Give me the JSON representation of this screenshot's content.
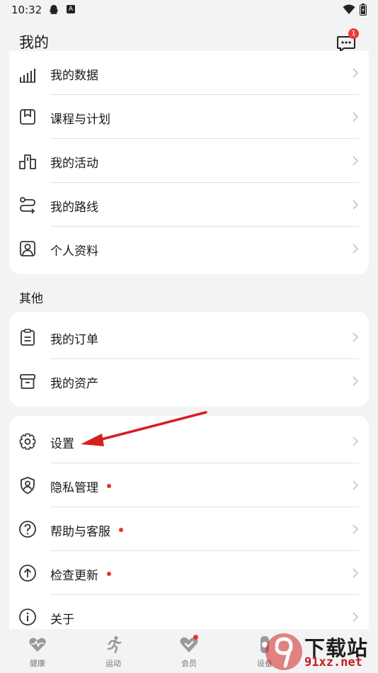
{
  "status": {
    "time": "10:32"
  },
  "header": {
    "title": "我的",
    "message_badge": "1"
  },
  "my_card": {
    "items": [
      {
        "label": "我的数据",
        "icon": "bar-chart-icon"
      },
      {
        "label": "课程与计划",
        "icon": "bookmark-icon"
      },
      {
        "label": "我的活动",
        "icon": "podium-icon"
      },
      {
        "label": "我的路线",
        "icon": "route-icon"
      },
      {
        "label": "个人资料",
        "icon": "profile-icon"
      }
    ]
  },
  "other_section": {
    "title": "其他",
    "items": [
      {
        "label": "我的订单",
        "icon": "clipboard-icon"
      },
      {
        "label": "我的资产",
        "icon": "box-icon"
      }
    ]
  },
  "settings_card": {
    "items": [
      {
        "label": "设置",
        "icon": "gear-icon",
        "dot": false
      },
      {
        "label": "隐私管理",
        "icon": "shield-user-icon",
        "dot": true
      },
      {
        "label": "帮助与客服",
        "icon": "help-icon",
        "dot": true
      },
      {
        "label": "检查更新",
        "icon": "upload-icon",
        "dot": true
      },
      {
        "label": "关于",
        "icon": "info-icon",
        "dot": false
      }
    ]
  },
  "tabbar": {
    "tabs": [
      {
        "label": "健康",
        "icon": "heart-pulse-icon"
      },
      {
        "label": "运动",
        "icon": "running-icon"
      },
      {
        "label": "会员",
        "icon": "vip-heart-icon"
      },
      {
        "label": "设备",
        "icon": "device-icon"
      }
    ]
  },
  "watermark": {
    "line1": "下载站",
    "line2": "91xz.net"
  },
  "colors": {
    "accent_red": "#e5322d",
    "background": "#f1f3f5",
    "card": "#ffffff",
    "arrow": "#d61f1f"
  }
}
